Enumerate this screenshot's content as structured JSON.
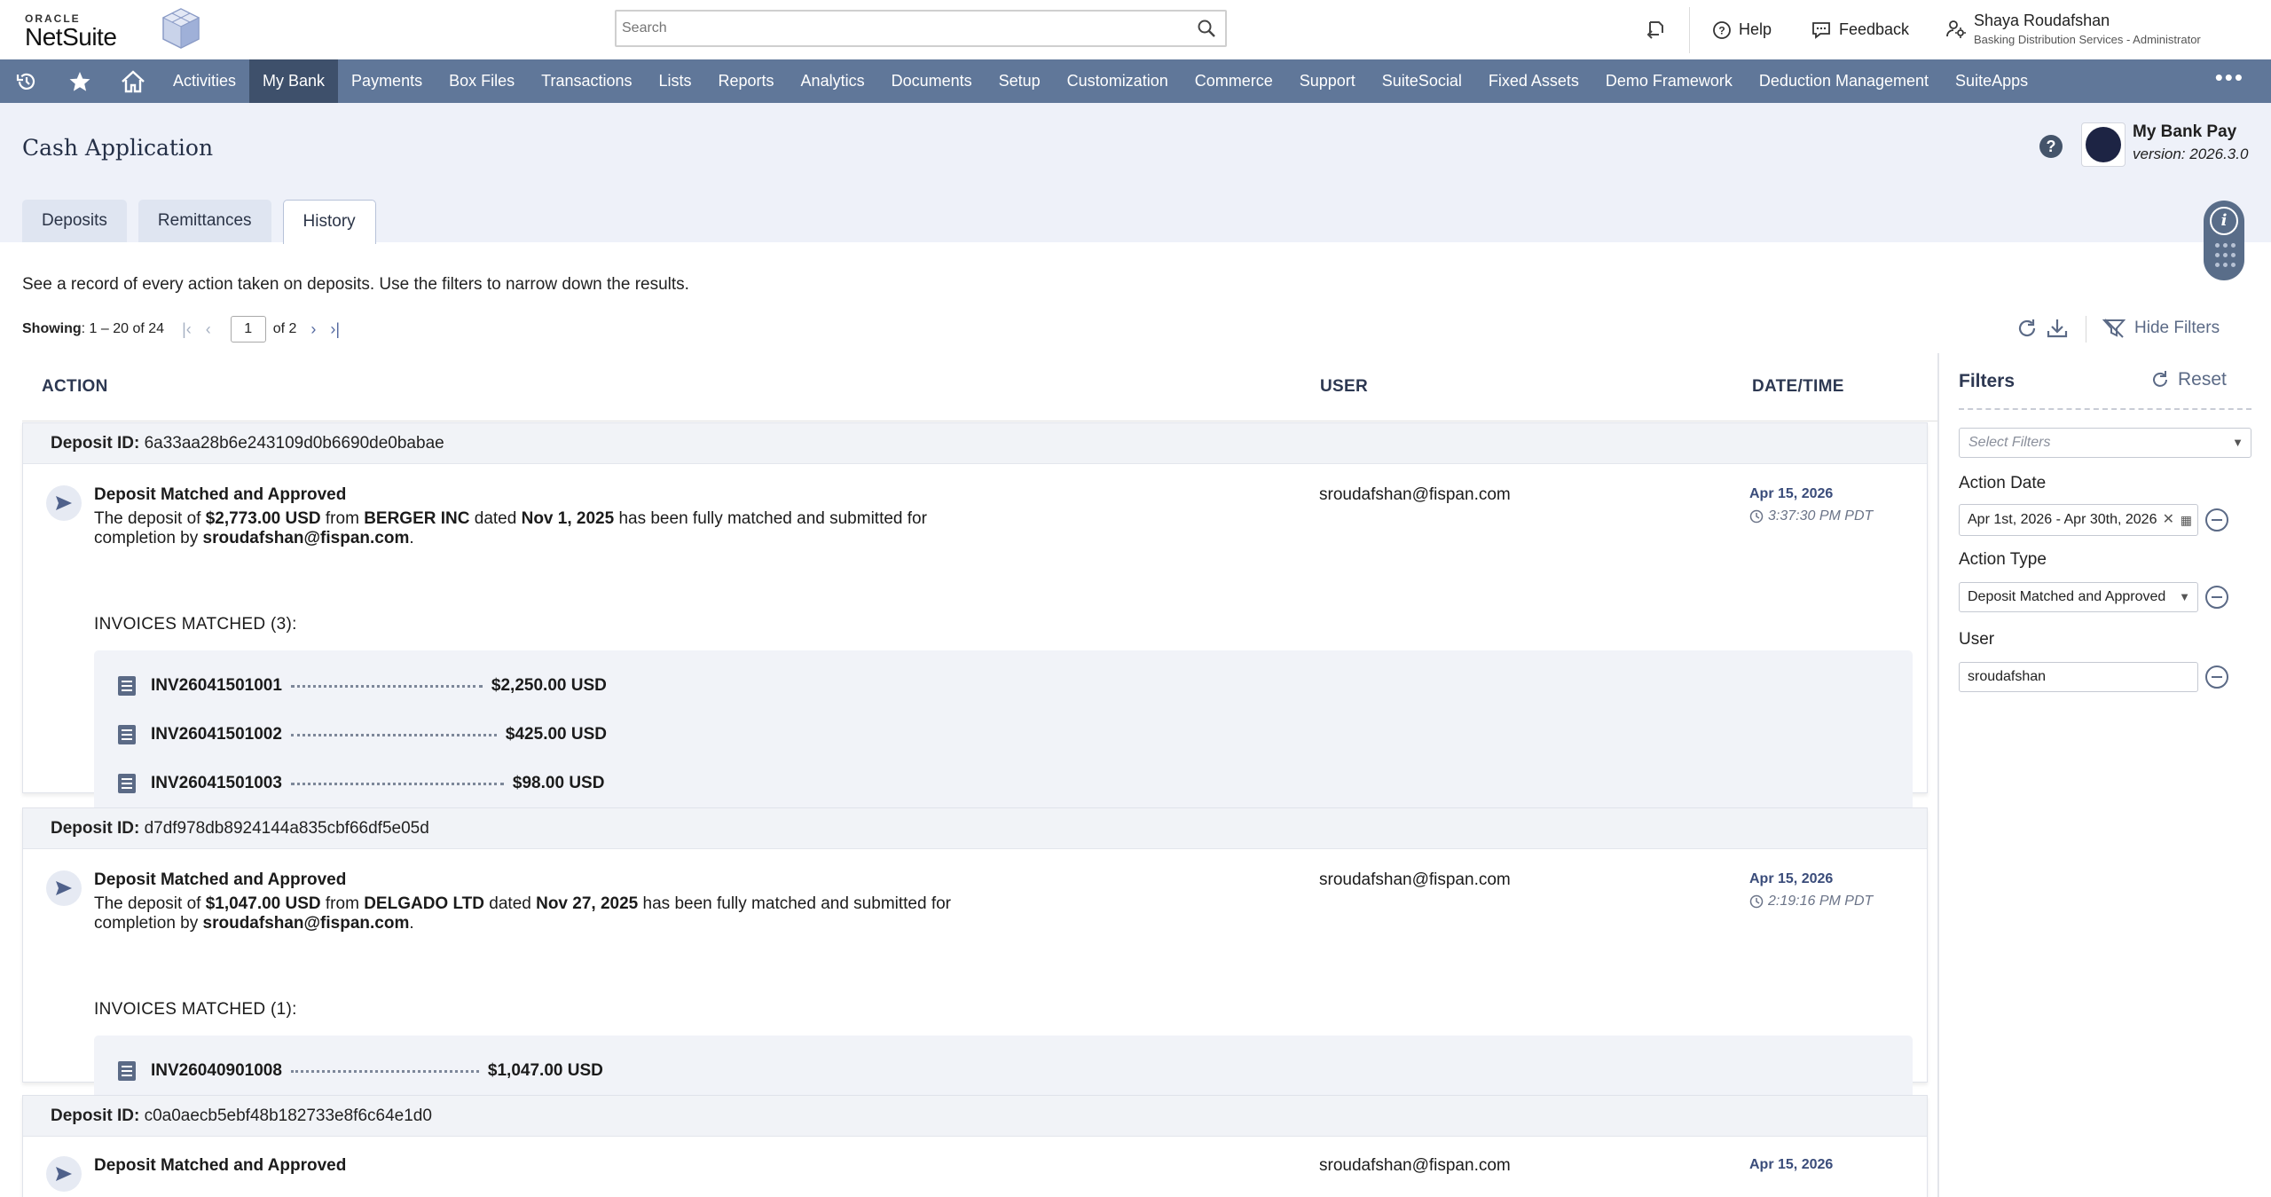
{
  "header": {
    "logo_oracle": "ORACLE",
    "logo_netsuite": "NetSuite",
    "search_placeholder": "Search",
    "help_label": "Help",
    "feedback_label": "Feedback",
    "user_name": "Shaya Roudafshan",
    "user_role": "Basking Distribution Services - Administrator"
  },
  "nav": {
    "items": [
      "Activities",
      "My Bank",
      "Payments",
      "Box Files",
      "Transactions",
      "Lists",
      "Reports",
      "Analytics",
      "Documents",
      "Setup",
      "Customization",
      "Commerce",
      "Support",
      "SuiteSocial",
      "Fixed Assets",
      "Demo Framework",
      "Deduction Management",
      "SuiteApps"
    ],
    "active": "My Bank",
    "more": "•••"
  },
  "page": {
    "title": "Cash Application",
    "app_name": "My Bank Pay",
    "app_version": "version: 2026.3.0",
    "tabs": [
      "Deposits",
      "Remittances",
      "History"
    ],
    "active_tab": "History",
    "intro": "See a record of every action taken on deposits. Use the filters to narrow down the results."
  },
  "paging": {
    "showing_label": "Showing",
    "showing_range": ": 1 – 20 of 24",
    "page": "1",
    "of": "of 2"
  },
  "toolbar": {
    "hide_filters": "Hide Filters"
  },
  "table": {
    "columns": {
      "action": "ACTION",
      "user": "USER",
      "datetime": "DATE/TIME"
    },
    "deposit_id_label": "Deposit ID:",
    "groups": [
      {
        "deposit_id": "6a33aa28b6e243109d0b6690de0babae",
        "title": "Deposit Matched and Approved",
        "desc_1": "The deposit of ",
        "amount": "$2,773.00 USD",
        "desc_2": " from ",
        "customer": "BERGER INC",
        "desc_3": " dated ",
        "date": "Nov 1, 2025",
        "desc_4": " has been fully matched and submitted for completion by ",
        "by": "sroudafshan@fispan.com",
        "desc_5": ".",
        "invoices_label": "INVOICES MATCHED (3):",
        "invoices": [
          {
            "number": "INV26041501001",
            "amount": "$2,250.00 USD"
          },
          {
            "number": "INV26041501002",
            "amount": "$425.00 USD"
          },
          {
            "number": "INV26041501003",
            "amount": "$98.00 USD"
          }
        ],
        "user": "sroudafshan@fispan.com",
        "date_cell": "Apr 15, 2026",
        "time_cell": "3:37:30 PM PDT"
      },
      {
        "deposit_id": "d7df978db8924144a835cbf66df5e05d",
        "title": "Deposit Matched and Approved",
        "desc_1": "The deposit of ",
        "amount": "$1,047.00 USD",
        "desc_2": " from ",
        "customer": "DELGADO LTD",
        "desc_3": " dated ",
        "date": "Nov 27, 2025",
        "desc_4": " has been fully matched and submitted for completion by ",
        "by": "sroudafshan@fispan.com",
        "desc_5": ".",
        "invoices_label": "INVOICES MATCHED (1):",
        "invoices": [
          {
            "number": "INV26040901008",
            "amount": "$1,047.00 USD"
          }
        ],
        "user": "sroudafshan@fispan.com",
        "date_cell": "Apr 15, 2026",
        "time_cell": "2:19:16 PM PDT"
      },
      {
        "deposit_id": "c0a0aecb5ebf48b182733e8f6c64e1d0",
        "title": "Deposit Matched and Approved",
        "user": "sroudafshan@fispan.com",
        "date_cell": "Apr 15, 2026"
      }
    ]
  },
  "filters": {
    "title": "Filters",
    "reset": "Reset",
    "select_placeholder": "Select Filters",
    "action_date_label": "Action Date",
    "action_date_value": "Apr 1st, 2026 - Apr 30th, 2026",
    "action_type_label": "Action Type",
    "action_type_value": "Deposit Matched and Approved",
    "user_label": "User",
    "user_value": "sroudafshan"
  },
  "colors": {
    "nav_bg": "#607799",
    "nav_active": "#3e506b",
    "page_head_bg": "#eef1f9",
    "accent": "#3a4c7a"
  }
}
